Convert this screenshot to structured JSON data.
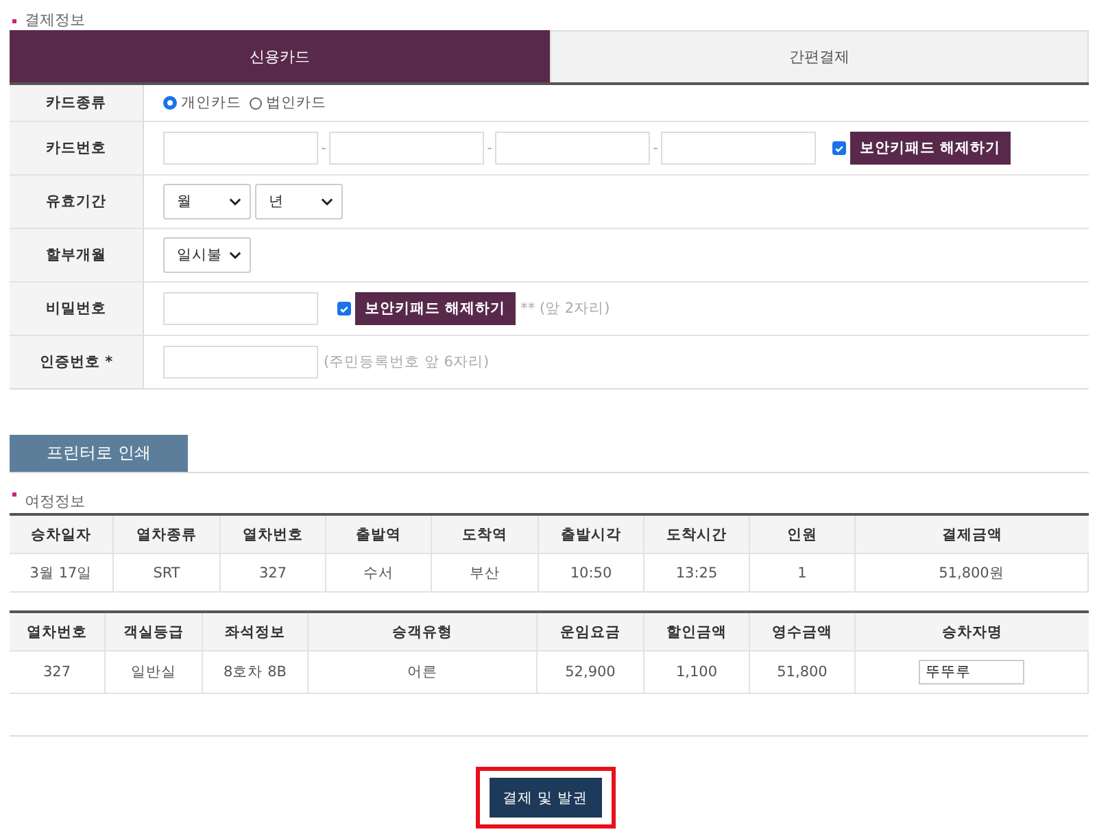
{
  "payment_section": {
    "title": "결제정보"
  },
  "tabs": [
    {
      "label": "신용카드",
      "selected": true
    },
    {
      "label": "간편결제",
      "selected": false
    }
  ],
  "form_rows": [
    {
      "label": "카드종류",
      "kind": "radio",
      "options": [
        {
          "label": "개인카드",
          "selected": true
        },
        {
          "label": "법인카드",
          "selected": false
        }
      ]
    },
    {
      "label": "카드번호",
      "kind": "card_number",
      "separator": "-",
      "keypad_checked": true,
      "keypad_button": "보안키패드 해제하기"
    },
    {
      "label": "유효기간",
      "kind": "selects",
      "selects": [
        {
          "value": "월"
        },
        {
          "value": "년"
        }
      ]
    },
    {
      "label": "할부개월",
      "kind": "selects",
      "selects": [
        {
          "value": "일시불"
        }
      ]
    },
    {
      "label": "비밀번호",
      "kind": "password",
      "keypad_checked": true,
      "keypad_button": "보안키패드 해제하기",
      "hint": "** (앞 2자리)"
    },
    {
      "label": "인증번호 *",
      "kind": "text",
      "hint": "(주민등록번호 앞 6자리)"
    }
  ],
  "print_button": "프린터로 인쇄",
  "trip_section": {
    "title": "여정정보"
  },
  "trip_table": {
    "columns": [
      "승차일자",
      "열차종류",
      "열차번호",
      "출발역",
      "도착역",
      "출발시각",
      "도착시간",
      "인원",
      "결제금액"
    ],
    "rows": [
      [
        "3월 17일",
        "SRT",
        "327",
        "수서",
        "부산",
        "10:50",
        "13:25",
        "1",
        "51,800원"
      ]
    ]
  },
  "ticket_table": {
    "columns": [
      "열차번호",
      "객실등급",
      "좌석정보",
      "승객유형",
      "운임요금",
      "할인금액",
      "영수금액",
      "승차자명"
    ],
    "rows": [
      {
        "cells": [
          "327",
          "일반실",
          "8호차 8B",
          "어른",
          "52,900",
          "1,100",
          "51,800"
        ],
        "passenger_name": "뚜뚜루"
      }
    ]
  },
  "submit_button": "결제 및 발권"
}
